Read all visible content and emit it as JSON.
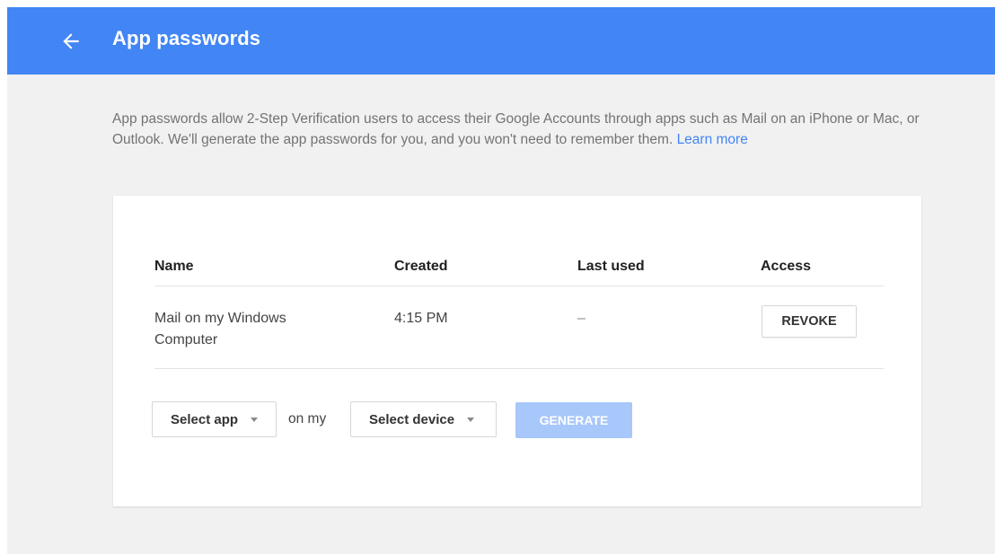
{
  "header": {
    "title": "App passwords",
    "back_icon": "arrow-back-icon",
    "background_color": "#4285f4"
  },
  "intro": {
    "text": "App passwords allow 2-Step Verification users to access their Google Accounts through apps such as Mail on an iPhone or Mac, or Outlook. We'll generate the app passwords for you, and you won't need to remember them. ",
    "learn_more": "Learn more",
    "link_color": "#4285f4"
  },
  "table": {
    "headers": {
      "name": "Name",
      "created": "Created",
      "last_used": "Last used",
      "access": "Access"
    },
    "rows": [
      {
        "name": "Mail on my Windows Computer",
        "created": "4:15 PM",
        "last_used": "–",
        "action": "REVOKE"
      }
    ]
  },
  "generator": {
    "select_app": "Select app",
    "on_my": "on my",
    "select_device": "Select device",
    "generate_label": "GENERATE",
    "generate_enabled": false,
    "generate_color": "#a8c7fa",
    "dropdown_icon": "caret-down-icon"
  }
}
